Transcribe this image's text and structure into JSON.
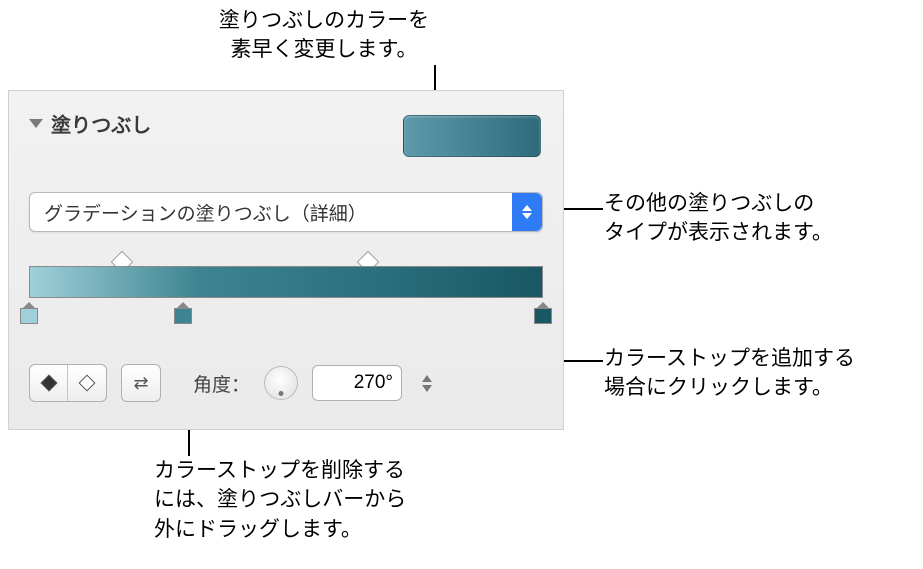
{
  "callouts": {
    "quickChange": "塗りつぶしのカラーを\n素早く変更します。",
    "otherTypes": "その他の塗りつぶしの\nタイプが表示されます。",
    "addStop": "カラーストップを追加する\n場合にクリックします。",
    "removeStop": "カラーストップを削除する\nには、塗りつぶしバーから\n外にドラッグします。"
  },
  "panel": {
    "sectionTitle": "塗りつぶし",
    "fillType": "グラデーションの塗りつぶし（詳細）",
    "gradient": {
      "stops": [
        {
          "position": 0,
          "color": "#9fd0da"
        },
        {
          "position": 30,
          "color": "#3e8490"
        },
        {
          "position": 100,
          "color": "#195863"
        }
      ],
      "midpoints": [
        18,
        66
      ]
    },
    "angle": {
      "label": "角度：",
      "value": "270°"
    }
  }
}
